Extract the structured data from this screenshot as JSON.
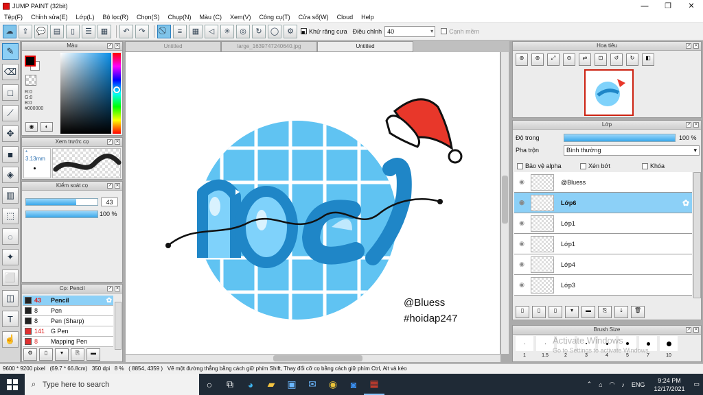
{
  "window": {
    "title": "JUMP PAINT (32bit)"
  },
  "menu": [
    "Tệp(F)",
    "Chỉnh sửa(E)",
    "Lớp(L)",
    "Bộ lọc(R)",
    "Chọn(S)",
    "Chụp(N)",
    "Màu (C)",
    "Xem(V)",
    "Công cụ(T)",
    "Cửa sổ(W)",
    "Cloud",
    "Help"
  ],
  "toolbar": {
    "antialias_label": "Khử răng cưa",
    "adjust_label": "Điều chỉnh",
    "adjust_value": "40",
    "snap_label": "Cạnh mềm"
  },
  "color_panel": {
    "title": "Màu",
    "r": "R:0",
    "g": "G:0",
    "b": "B:0",
    "hex": "#000000",
    "fg": "#000000",
    "bg": "#ffffff"
  },
  "preview_panel": {
    "title": "Xem trước cọ",
    "size": "* 3.13mm"
  },
  "control_panel": {
    "title": "Kiểm soát cọ",
    "size_value": "43",
    "size_fraction": 0.7,
    "opacity_value": "100 %",
    "opacity_fraction": 1.0
  },
  "brush_panel": {
    "title": "Cọ: Pencil",
    "items": [
      {
        "size": "43",
        "name": "Pencil",
        "color": "#222222",
        "selected": true
      },
      {
        "size": "8",
        "name": "Pen",
        "color": "#222222",
        "selected": false
      },
      {
        "size": "8",
        "name": "Pen (Sharp)",
        "color": "#222222",
        "selected": false
      },
      {
        "size": "141",
        "name": "G Pen",
        "color": "#e03030",
        "selected": false
      },
      {
        "size": "8",
        "name": "Mapping Pen",
        "color": "#e03030",
        "selected": false
      }
    ]
  },
  "tabs": [
    "Untitled",
    "large_1639747240640.jpg",
    "Untitled"
  ],
  "canvas": {
    "credit": "@Bluess",
    "hashtag": "#hoidap247"
  },
  "nav_panel": {
    "title": "Hoa tiêu"
  },
  "layer_panel": {
    "title": "Lớp",
    "opacity_label": "Độ trong",
    "opacity_value": "100 %",
    "blend_label": "Pha trộn",
    "blend_value": "Bình thường",
    "protect_alpha": "Bảo vệ alpha",
    "clip": "Xén bớt",
    "lock": "Khóa",
    "layers": [
      {
        "name": "@Bluess",
        "selected": false
      },
      {
        "name": "Lớp6",
        "selected": true
      },
      {
        "name": "Lớp1",
        "selected": false
      },
      {
        "name": "Lớp1",
        "selected": false
      },
      {
        "name": "Lớp4",
        "selected": false
      },
      {
        "name": "Lớp3",
        "selected": false
      }
    ]
  },
  "size_panel": {
    "title": "Brush Size",
    "labels": [
      "1",
      "1.5",
      "2",
      "3",
      "4",
      "5",
      "7",
      "10"
    ],
    "watermark_line1": "Activate Windows",
    "watermark_line2": "Go to Settings to activate Windows."
  },
  "status": {
    "dims": "9600 * 9200 pixel",
    "physical": "(69.7 * 66.8cm)",
    "dpi": "350 dpi",
    "zoom": "8 %",
    "coords": "( 8854, 4359 )",
    "hint": "Vẽ một đường thẳng bằng cách giữ phím Shift, Thay đổi cỡ cọ bằng cách giữ phím Ctrl, Alt và kéo"
  },
  "taskbar": {
    "search_placeholder": "Type here to search",
    "lang": "ENG",
    "time": "9:24 PM",
    "date": "12/17/2021"
  }
}
